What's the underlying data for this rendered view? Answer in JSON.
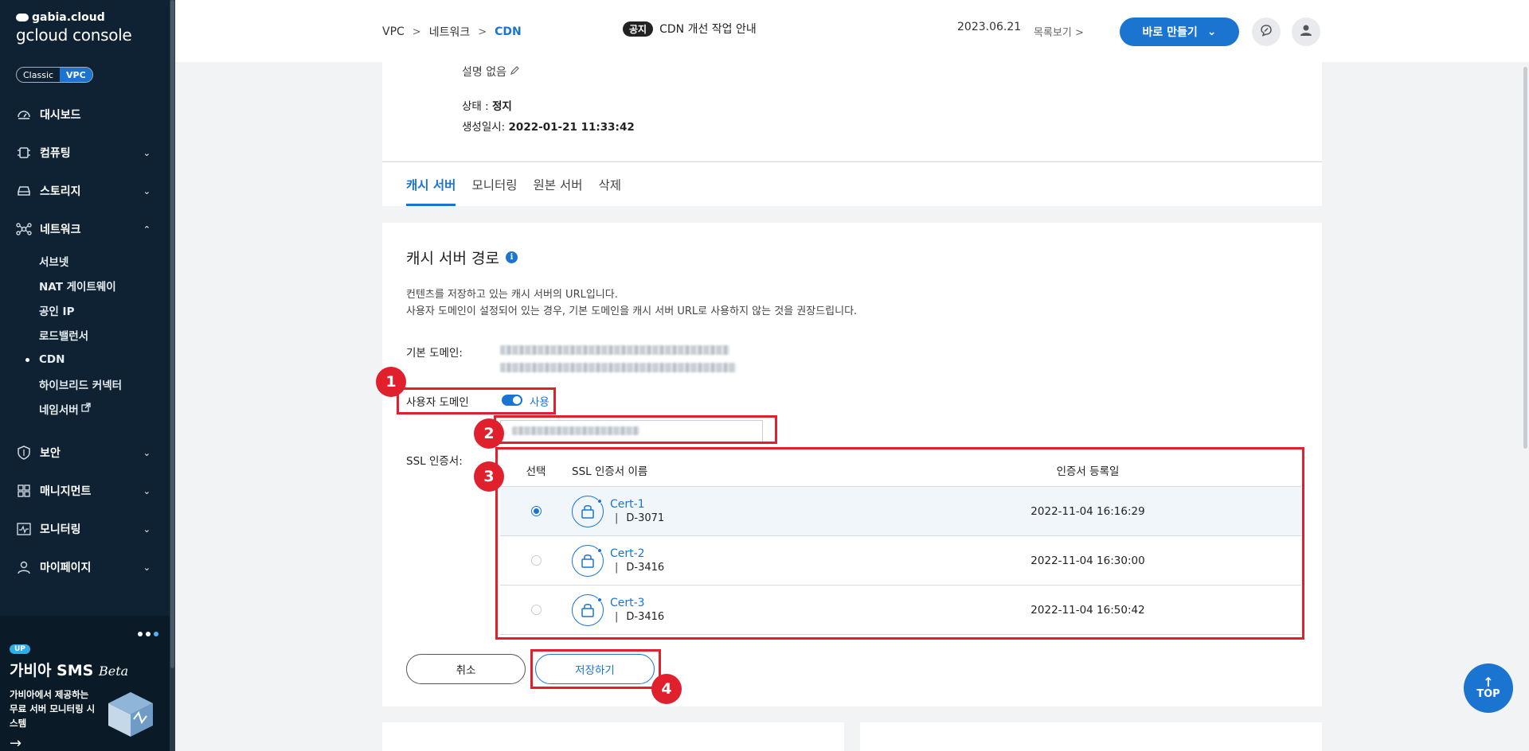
{
  "brand": {
    "small": "gabia.cloud",
    "big": "gcloud console"
  },
  "mode_toggle": {
    "classic": "Classic",
    "vpc": "VPC"
  },
  "sidebar": {
    "items": [
      {
        "label": "대시보드",
        "icon": "dashboard-icon"
      },
      {
        "label": "컴퓨팅",
        "icon": "chip-icon"
      },
      {
        "label": "스토리지",
        "icon": "storage-icon"
      },
      {
        "label": "네트워크",
        "icon": "network-icon"
      }
    ],
    "network_sub": [
      "서브넷",
      "NAT 게이트웨이",
      "공인 IP",
      "로드밸런서",
      "CDN",
      "하이브리드 커넥터",
      "네임서버"
    ],
    "items_bottom": [
      {
        "label": "보안",
        "icon": "shield-icon"
      },
      {
        "label": "매니지먼트",
        "icon": "management-icon"
      },
      {
        "label": "모니터링",
        "icon": "monitor-icon"
      },
      {
        "label": "마이페이지",
        "icon": "user-icon"
      }
    ]
  },
  "promo": {
    "badge": "UP",
    "title": "가비아 SMS",
    "beta": "Beta",
    "desc": "가비아에서 제공하는 무료 서버 모니터링 시스템"
  },
  "header": {
    "breadcrumb": [
      "VPC",
      "네트워크",
      "CDN"
    ],
    "notice_badge": "공지",
    "notice_text": "CDN 개선 작업 안내",
    "date": "2023.06.21",
    "list_view": "목록보기",
    "create_button": "바로 만들기"
  },
  "info": {
    "desc": "설명 없음",
    "status_label": "상태 : ",
    "status_value": "정지",
    "created_label": "생성일시: ",
    "created_value": "2022-01-21 11:33:42"
  },
  "tabs": [
    "캐시 서버",
    "모니터링",
    "원본 서버",
    "삭제"
  ],
  "cache_path": {
    "title": "캐시 서버 경로",
    "desc_line1": "컨텐츠를 저장하고 있는 캐시 서버의 URL입니다.",
    "desc_line2": "사용자 도메인이 설정되어 있는 경우, 기본 도메인을 캐시 서버 URL로 사용하지 않는 것을 권장드립니다.",
    "base_domain_label": "기본 도메인:",
    "user_domain_label": "사용자 도메인",
    "user_domain_toggle": "사용",
    "ssl_label": "SSL 인증서:"
  },
  "cert_table": {
    "headers": [
      "선택",
      "SSL 인증서 이름",
      "인증서 등록일"
    ],
    "rows": [
      {
        "name": "Cert-1",
        "id": "D-3071",
        "date": "2022-11-04 16:16:29",
        "selected": true
      },
      {
        "name": "Cert-2",
        "id": "D-3416",
        "date": "2022-11-04 16:30:00",
        "selected": false
      },
      {
        "name": "Cert-3",
        "id": "D-3416",
        "date": "2022-11-04 16:50:42",
        "selected": false
      }
    ]
  },
  "buttons": {
    "cancel": "취소",
    "save": "저장하기"
  },
  "annotations": [
    "1",
    "2",
    "3",
    "4"
  ],
  "top_button": "TOP",
  "colors": {
    "accent": "#1a74d0",
    "sidebar": "#0e2233",
    "highlight": "#e0202d"
  }
}
